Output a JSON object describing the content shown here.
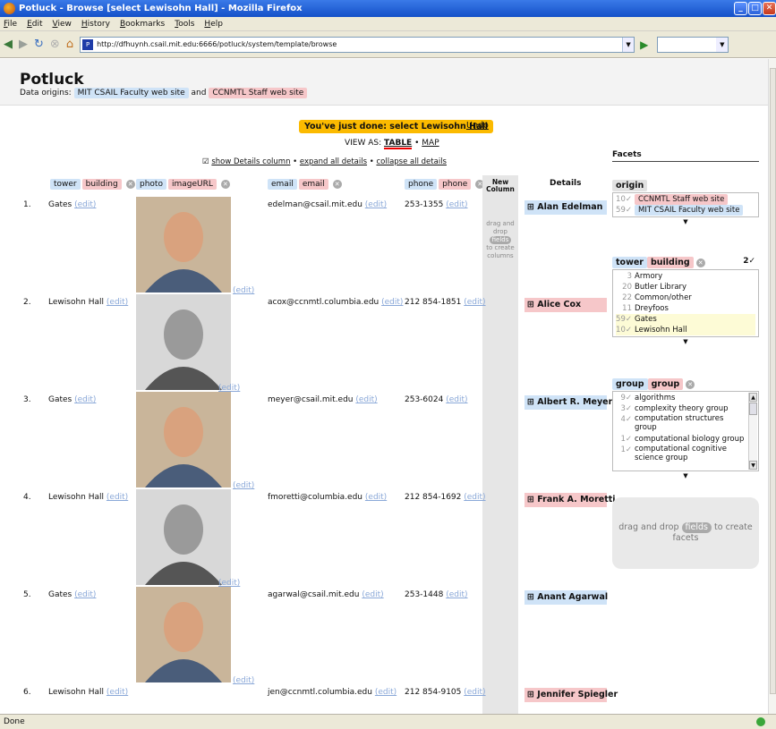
{
  "window": {
    "title": "Potluck - Browse [select Lewisohn Hall] - Mozilla Firefox"
  },
  "menu": [
    "File",
    "Edit",
    "View",
    "History",
    "Bookmarks",
    "Tools",
    "Help"
  ],
  "url": "http://dfhuynh.csail.mit.edu:6666/potluck/system/template/browse",
  "status": "Done",
  "header": {
    "title": "Potluck",
    "origins_label": "Data origins:",
    "origin1": "MIT CSAIL Faculty web site",
    "and": "and",
    "origin2": "CCNMTL Staff web site"
  },
  "notice": {
    "text": "You've just done: select Lewisohn Hall",
    "undo": "Undo"
  },
  "viewas": {
    "label": "VIEW AS:",
    "table": "TABLE",
    "sep": "•",
    "map": "MAP"
  },
  "showdetails": {
    "check": "☑",
    "show": "show Details column",
    "expand": "expand all details",
    "collapse": "collapse all details"
  },
  "columns": {
    "tower": "tower",
    "building": "building",
    "photo": "photo",
    "imageURL": "imageURL",
    "email1": "email",
    "email2": "email",
    "phone1": "phone",
    "phone2": "phone",
    "newcol": "New Column",
    "drag": "drag and drop",
    "fields": "fields",
    "create": "to create columns",
    "details": "Details"
  },
  "edit": "(edit)",
  "rows": [
    {
      "n": "1.",
      "bldg": "Gates",
      "email": "edelman@csail.mit.edu",
      "phone": "253-1355",
      "name": "Alan Edelman",
      "src": "blue"
    },
    {
      "n": "2.",
      "bldg": "Lewisohn Hall",
      "email": "acox@ccnmtl.columbia.edu",
      "phone": "212 854-1851",
      "name": "Alice Cox",
      "src": "pink"
    },
    {
      "n": "3.",
      "bldg": "Gates",
      "email": "meyer@csail.mit.edu",
      "phone": "253-6024",
      "name": "Albert R. Meyer",
      "src": "blue"
    },
    {
      "n": "4.",
      "bldg": "Lewisohn Hall",
      "email": "fmoretti@columbia.edu",
      "phone": "212 854-1692",
      "name": "Frank A. Moretti",
      "src": "pink"
    },
    {
      "n": "5.",
      "bldg": "Gates",
      "email": "agarwal@csail.mit.edu",
      "phone": "253-1448",
      "name": "Anant Agarwal",
      "src": "blue"
    },
    {
      "n": "6.",
      "bldg": "Lewisohn Hall",
      "email": "jen@ccnmtl.columbia.edu",
      "phone": "212 854-9105",
      "name": "Jennifer Spiegler",
      "src": "pink"
    }
  ],
  "facets": {
    "title": "Facets",
    "origin": {
      "label": "origin",
      "items": [
        {
          "count": "10",
          "label": "CCNMTL Staff web site"
        },
        {
          "count": "59",
          "label": "MIT CSAIL Faculty web site"
        }
      ]
    },
    "tower": {
      "label1": "tower",
      "label2": "building",
      "selcount": "2✓",
      "items": [
        {
          "count": "3",
          "label": "Armory"
        },
        {
          "count": "20",
          "label": "Butler Library"
        },
        {
          "count": "22",
          "label": "Common/other"
        },
        {
          "count": "11",
          "label": "Dreyfoos"
        },
        {
          "count": "59✓",
          "label": "Gates"
        },
        {
          "count": "10✓",
          "label": "Lewisohn Hall"
        }
      ]
    },
    "group": {
      "label1": "group",
      "label2": "group",
      "items": [
        {
          "count": "9",
          "label": "algorithms"
        },
        {
          "count": "3",
          "label": "complexity theory group"
        },
        {
          "count": "4",
          "label": "computation structures group"
        },
        {
          "count": "1",
          "label": "computational biology group"
        },
        {
          "count": "1",
          "label": "computational cognitive science group"
        }
      ]
    },
    "drop": {
      "pre": "drag and drop",
      "fields": "fields",
      "post": "to create facets"
    }
  },
  "colors": {
    "blue": "#cfe3f7",
    "pink": "#f6c7c9",
    "notice": "#fbba00"
  }
}
